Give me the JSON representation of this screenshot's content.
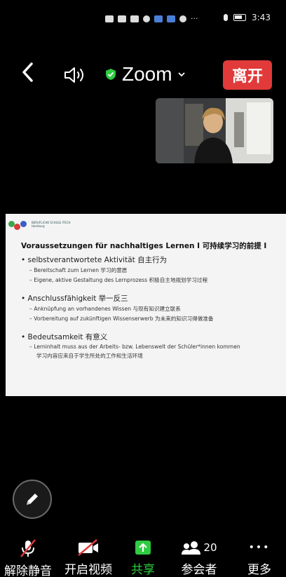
{
  "status_bar": {
    "time": "3:43",
    "more": "···"
  },
  "header": {
    "title": "Zoom",
    "leave_label": "离开"
  },
  "slide": {
    "title": "Voraussetzungen für nachhaltiges Lernen I   可持续学习的前提 I",
    "sections": [
      {
        "heading": "selbstverantwortete Aktivität  自主行为",
        "points": [
          "Bereitschaft zum Lernen   学习的意愿",
          "Eigene, aktive Gestaltung des Lernprozess 积极自主地规划学习过程"
        ]
      },
      {
        "heading": "Anschlussfähigkeit  举一反三",
        "points": [
          "Anknüpfung an vorhandenes Wissen   与现有知识建立联系",
          "Vorbereitung auf zukünftigen Wissenserwerb  为未来的知识习得做准备"
        ]
      },
      {
        "heading": "Bedeutsamkeit   有意义",
        "points": [
          "Lerninhalt muss aus der Arbeits- bzw. Lebenswelt der Schüler*innen kommen"
        ],
        "extra": "学习内容应来自于学生所处的工作和生活环境"
      }
    ]
  },
  "toolbar": {
    "unmute_label": "解除静音",
    "video_label": "开启视频",
    "share_label": "共享",
    "participants_label": "参会者",
    "participants_count": "20",
    "more_label": "更多",
    "more_dots": "•••"
  },
  "colors": {
    "leave": "#e03a3a",
    "share_green": "#2ecc40",
    "shield_green": "#2ecc40"
  }
}
